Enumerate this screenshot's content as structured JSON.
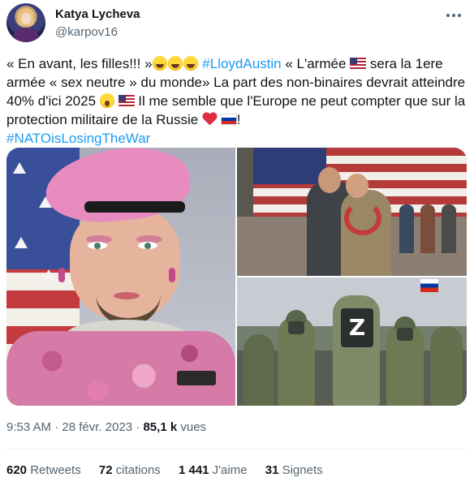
{
  "author": {
    "display_name": "Katya Lycheva",
    "handle": "@karpov16"
  },
  "tweet": {
    "segments": {
      "p1": "« En avant, les filles!!! »",
      "hashtag1": "#LloydAustin",
      "p2": " « L'armée ",
      "p3": " sera la 1ere armée « sex neutre » du monde» La part des non-binaires devrait atteindre 40% d'ici 2025 ",
      "p4": " Il me semble que l'Europe ne peut compter que sur la protection militaire de la Russie ",
      "p5": "!",
      "hashtag2": "#NATOisLosingTheWar"
    },
    "emoji": [
      "face-with-tears-of-joy",
      "us-flag",
      "astonished-face",
      "red-heart",
      "russia-flag"
    ]
  },
  "media": {
    "images": [
      {
        "name": "image-pink-beret-soldier"
      },
      {
        "name": "image-military-homecoming"
      },
      {
        "name": "image-russian-soldiers"
      }
    ],
    "z_letter": "Z"
  },
  "meta": {
    "time": "9:53 AM",
    "dot1": " · ",
    "date": "28 févr. 2023",
    "dot2": " · ",
    "views_count": "85,1 k",
    "views_label": " vues"
  },
  "stats": {
    "retweets_count": "620",
    "retweets_label": " Retweets",
    "quotes_count": "72",
    "quotes_label": " citations",
    "likes_count": "1 441",
    "likes_label": " J'aime",
    "bookmarks_count": "31",
    "bookmarks_label": " Signets"
  },
  "colors": {
    "link": "#1d9bf0",
    "text": "#0f1419",
    "secondary": "#536471"
  }
}
